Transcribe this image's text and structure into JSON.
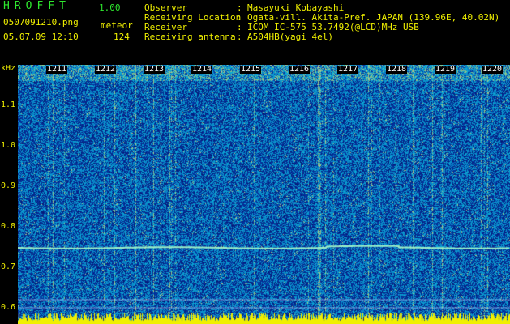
{
  "header": {
    "logo": "HROFFT",
    "version": "1.00",
    "filename": "0507091210.png",
    "mode": "meteor",
    "datetime": "05.07.09 12:10",
    "count": "124",
    "info": [
      {
        "label": "Observer",
        "value": "Masayuki Kobayashi"
      },
      {
        "label": "Receiving Location",
        "value": "Ogata-vill. Akita-Pref. JAPAN (139.96E, 40.02N)"
      },
      {
        "label": "Receiver",
        "value": "ICOM IC-575 53.7492(@LCD)MHz USB"
      },
      {
        "label": "Receiving antenna",
        "value": "A504HB(yagi 4el)"
      }
    ]
  },
  "spectrogram": {
    "y_unit": "kHz",
    "y_ticks": [
      "1.1",
      "1.0",
      "0.9",
      "0.8",
      "0.7",
      "0.6"
    ],
    "x_ticks": [
      "1211",
      "1212",
      "1213",
      "1214",
      "1215",
      "1216",
      "1217",
      "1218",
      "1219",
      "1220"
    ]
  },
  "colors": {
    "background": "#000000",
    "spectrogram_base": "#0a1a8a",
    "signal_line": "#9cf0c8",
    "header_green": "#2ee82e",
    "header_yellow": "#f0f000",
    "bottom_bar": "#f0f000"
  }
}
